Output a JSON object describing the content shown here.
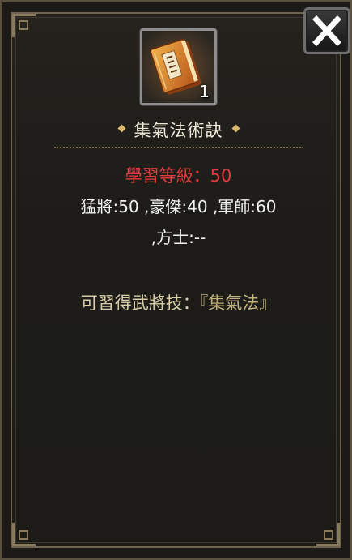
{
  "item": {
    "name": "集氣法術訣",
    "count": "1",
    "icon": "scroll-book-icon"
  },
  "requirements": {
    "level_text": "學習等級：50",
    "stats_line1": "猛將:50 ,豪傑:40 ,軍師:60",
    "stats_line2": ",方士:--"
  },
  "skill": {
    "prefix": "可習得武將技：",
    "name": "『集氣法』"
  },
  "colors": {
    "level_red": "#e03e3e",
    "skill_gold": "#c2b27c",
    "name_text": "#f1ead9",
    "frame_gold": "#8a7a5c"
  }
}
